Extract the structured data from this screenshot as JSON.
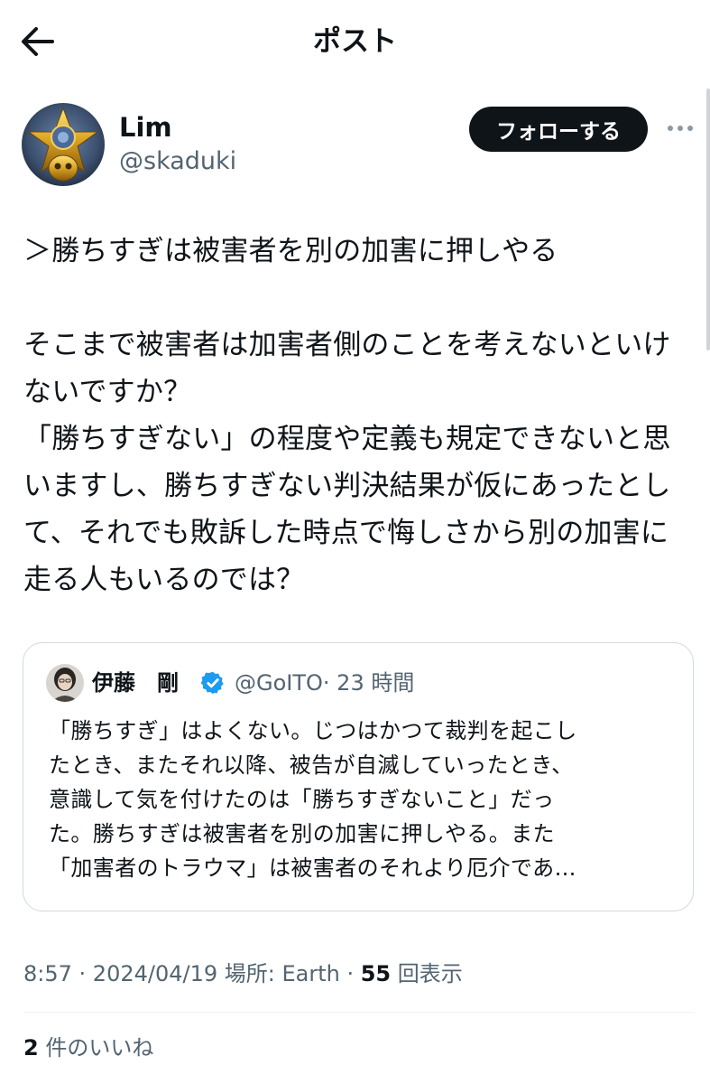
{
  "header": {
    "title": "ポスト",
    "back_icon": "arrow-left-icon"
  },
  "author": {
    "name": "Lim",
    "handle": "@skaduki",
    "follow_label": "フォローする",
    "more_icon": "more-dots-icon"
  },
  "post": {
    "lines": [
      "＞勝ちすぎは被害者を別の加害に押しやる",
      "",
      "そこまで被害者は加害者側のことを考えないといけ",
      "ないですか？",
      "「勝ちすぎない」の程度や定義も規定できないと思",
      "いますし、勝ちすぎない判決結果が仮にあったとし",
      "て、それでも敗訴した時点で悔しさから別の加害に",
      "走る人もいるのでは？"
    ]
  },
  "quote": {
    "name": "伊藤　剛",
    "verified_icon": "verified-badge-icon",
    "handle": "@GoITO",
    "time": "· 23 時間",
    "lines": [
      "「勝ちすぎ」はよくない。じつはかつて裁判を起こし",
      "たとき、またそれ以降、被告が自滅していったとき、",
      "意識して気を付けたのは「勝ちすぎないこと」だっ",
      "た。勝ちすぎは被害者を別の加害に押しやる。また",
      "「加害者のトラウマ」は被害者のそれより厄介であ…"
    ]
  },
  "meta": {
    "time": "8:57",
    "sep1": " · ",
    "date": "2024/04/19",
    "location": " 場所: Earth",
    "sep2": " · ",
    "views_count": "55",
    "views_label": " 回表示"
  },
  "likes": {
    "count": "2",
    "label": " 件のいいね"
  },
  "colors": {
    "text": "#0f1419",
    "secondary": "#536471",
    "verified": "#1d9bf0",
    "border": "#cfd9de"
  }
}
